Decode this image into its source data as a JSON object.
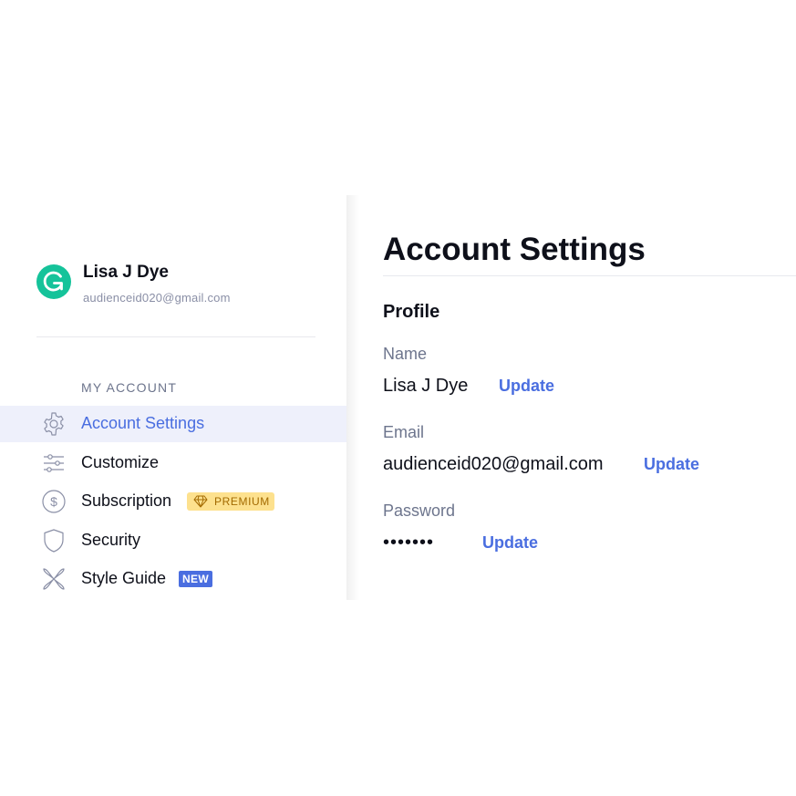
{
  "user": {
    "name": "Lisa J Dye",
    "email": "audienceid020@gmail.com"
  },
  "sidebar": {
    "section_label": "MY ACCOUNT",
    "items": [
      {
        "label": "Account Settings",
        "icon": "gear-icon",
        "active": true
      },
      {
        "label": "Customize",
        "icon": "sliders-icon"
      },
      {
        "label": "Subscription",
        "icon": "dollar-icon",
        "badge": "PREMIUM"
      },
      {
        "label": "Security",
        "icon": "shield-icon"
      },
      {
        "label": "Style Guide",
        "icon": "style-guide-icon",
        "badge": "NEW"
      }
    ]
  },
  "main": {
    "title": "Account Settings",
    "section": "Profile",
    "fields": [
      {
        "label": "Name",
        "value": "Lisa J Dye",
        "action": "Update"
      },
      {
        "label": "Email",
        "value": "audienceid020@gmail.com",
        "action": "Update"
      },
      {
        "label": "Password",
        "value": "•••••••",
        "action": "Update"
      }
    ]
  },
  "colors": {
    "brand": "#15c39a",
    "accent": "#4a6ee0",
    "active_bg": "#eef0fb",
    "premium_bg": "#fde18e"
  }
}
